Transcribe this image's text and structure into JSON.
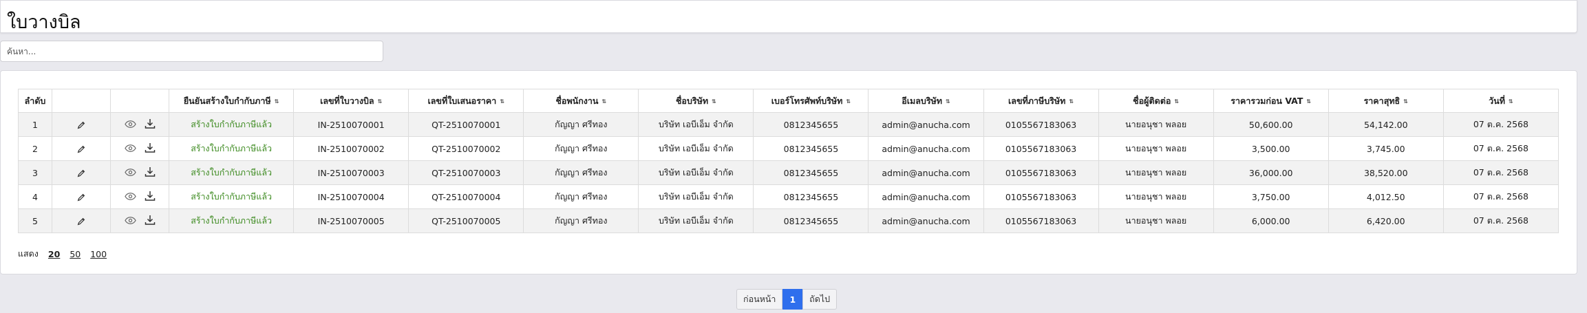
{
  "page": {
    "title": "ใบวางบิล"
  },
  "search": {
    "placeholder": "ค้นหา..."
  },
  "table": {
    "headers": [
      "ลำดับ",
      "",
      "",
      "ยืนยันสร้างใบกำกับภาษี",
      "เลขที่ใบวางบิล",
      "เลขที่ใบเสนอราคา",
      "ชื่อพนักงาน",
      "ชื่อบริษัท",
      "เบอร์โทรศัพท์บริษัท",
      "อีเมลบริษัท",
      "เลขที่ภาษีบริษัท",
      "ชื่อผู้ติดต่อ",
      "ราคารวมก่อน VAT",
      "ราคาสุทธิ",
      "วันที่"
    ],
    "sort_icon": "sort-updown-icon",
    "rows": [
      {
        "no": "1",
        "status": "สร้างใบกำกับภาษีแล้ว",
        "invoice_no": "IN-2510070001",
        "quote_no": "QT-2510070001",
        "employee": "กัญญา ศรีทอง",
        "company": "บริษัท เอบีเอ็ม จำกัด",
        "phone": "0812345655",
        "email": "admin@anucha.com",
        "tax_id": "0105567183063",
        "contact": "นายอนุชา พลอย",
        "pre_vat": "50,600.00",
        "net": "54,142.00",
        "date": "07 ต.ค. 2568"
      },
      {
        "no": "2",
        "status": "สร้างใบกำกับภาษีแล้ว",
        "invoice_no": "IN-2510070002",
        "quote_no": "QT-2510070002",
        "employee": "กัญญา ศรีทอง",
        "company": "บริษัท เอบีเอ็ม จำกัด",
        "phone": "0812345655",
        "email": "admin@anucha.com",
        "tax_id": "0105567183063",
        "contact": "นายอนุชา พลอย",
        "pre_vat": "3,500.00",
        "net": "3,745.00",
        "date": "07 ต.ค. 2568"
      },
      {
        "no": "3",
        "status": "สร้างใบกำกับภาษีแล้ว",
        "invoice_no": "IN-2510070003",
        "quote_no": "QT-2510070003",
        "employee": "กัญญา ศรีทอง",
        "company": "บริษัท เอบีเอ็ม จำกัด",
        "phone": "0812345655",
        "email": "admin@anucha.com",
        "tax_id": "0105567183063",
        "contact": "นายอนุชา พลอย",
        "pre_vat": "36,000.00",
        "net": "38,520.00",
        "date": "07 ต.ค. 2568"
      },
      {
        "no": "4",
        "status": "สร้างใบกำกับภาษีแล้ว",
        "invoice_no": "IN-2510070004",
        "quote_no": "QT-2510070004",
        "employee": "กัญญา ศรีทอง",
        "company": "บริษัท เอบีเอ็ม จำกัด",
        "phone": "0812345655",
        "email": "admin@anucha.com",
        "tax_id": "0105567183063",
        "contact": "นายอนุชา พลอย",
        "pre_vat": "3,750.00",
        "net": "4,012.50",
        "date": "07 ต.ค. 2568"
      },
      {
        "no": "5",
        "status": "สร้างใบกำกับภาษีแล้ว",
        "invoice_no": "IN-2510070005",
        "quote_no": "QT-2510070005",
        "employee": "กัญญา ศรีทอง",
        "company": "บริษัท เอบีเอ็ม จำกัด",
        "phone": "0812345655",
        "email": "admin@anucha.com",
        "tax_id": "0105567183063",
        "contact": "นายอนุชา พลอย",
        "pre_vat": "6,000.00",
        "net": "6,420.00",
        "date": "07 ต.ค. 2568"
      }
    ]
  },
  "page_size": {
    "label": "แสดง",
    "options": [
      "20",
      "50",
      "100"
    ],
    "selected": "20"
  },
  "pagination": {
    "prev": "ก่อนหน้า",
    "current": "1",
    "next": "ถัดไป"
  },
  "colors": {
    "status_green": "#3c8a1f",
    "accent_blue": "#2f6fed",
    "stripe": "#f2f2f2"
  }
}
